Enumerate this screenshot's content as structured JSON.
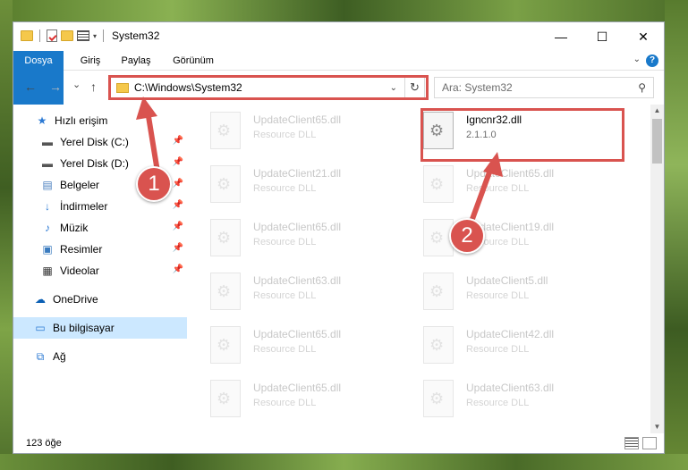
{
  "window": {
    "title": "System32",
    "controls": {
      "minimize": "—",
      "maximize": "☐",
      "close": "✕"
    }
  },
  "ribbon": {
    "tabs": [
      "Dosya",
      "Giriş",
      "Paylaş",
      "Görünüm"
    ],
    "help": "?"
  },
  "nav": {
    "back": "←",
    "forward": "→",
    "recent": "⌄",
    "up": "↑",
    "address": "C:\\Windows\\System32",
    "refresh": "↻",
    "search_placeholder": "Ara: System32"
  },
  "sidebar": {
    "items": [
      {
        "label": "Hızlı erişim",
        "icon": "star-icon"
      },
      {
        "label": "Yerel Disk (C:)",
        "icon": "drive-icon",
        "pinned": true
      },
      {
        "label": "Yerel Disk (D:)",
        "icon": "drive-icon",
        "pinned": true
      },
      {
        "label": "Belgeler",
        "icon": "documents-icon",
        "pinned": true
      },
      {
        "label": "İndirmeler",
        "icon": "download-icon",
        "pinned": true
      },
      {
        "label": "Müzik",
        "icon": "music-icon",
        "pinned": true
      },
      {
        "label": "Resimler",
        "icon": "pictures-icon",
        "pinned": true
      },
      {
        "label": "Videolar",
        "icon": "videos-icon",
        "pinned": true
      },
      {
        "label": "OneDrive",
        "icon": "cloud-icon"
      },
      {
        "label": "Bu bilgisayar",
        "icon": "computer-icon",
        "selected": true
      },
      {
        "label": "Ağ",
        "icon": "network-icon"
      }
    ]
  },
  "files": {
    "left_column": [
      {
        "name": "UpdateClient65.dll",
        "type": "Resource DLL"
      },
      {
        "name": "UpdateClient21.dll",
        "type": "Resource DLL"
      },
      {
        "name": "UpdateClient65.dll",
        "type": "Resource DLL"
      },
      {
        "name": "UpdateClient63.dll",
        "type": "Resource DLL"
      },
      {
        "name": "UpdateClient65.dll",
        "type": "Resource DLL"
      },
      {
        "name": "UpdateClient65.dll",
        "type": "Resource DLL"
      }
    ],
    "right_column": [
      {
        "name": "Igncnr32.dll",
        "type": "2.1.1.0",
        "highlighted": true
      },
      {
        "name": "UpdateClient65.dll",
        "type": "Resource DLL"
      },
      {
        "name": "UpdateClient19.dll",
        "type": "Resource DLL"
      },
      {
        "name": "UpdateClient5.dll",
        "type": "Resource DLL"
      },
      {
        "name": "UpdateClient42.dll",
        "type": "Resource DLL"
      },
      {
        "name": "UpdateClient63.dll",
        "type": "Resource DLL"
      }
    ]
  },
  "status": {
    "item_count": "123 öğe"
  },
  "callouts": [
    "1",
    "2"
  ],
  "colors": {
    "accent": "#1979ca",
    "highlight": "#d9534f",
    "selected": "#cce8ff"
  }
}
